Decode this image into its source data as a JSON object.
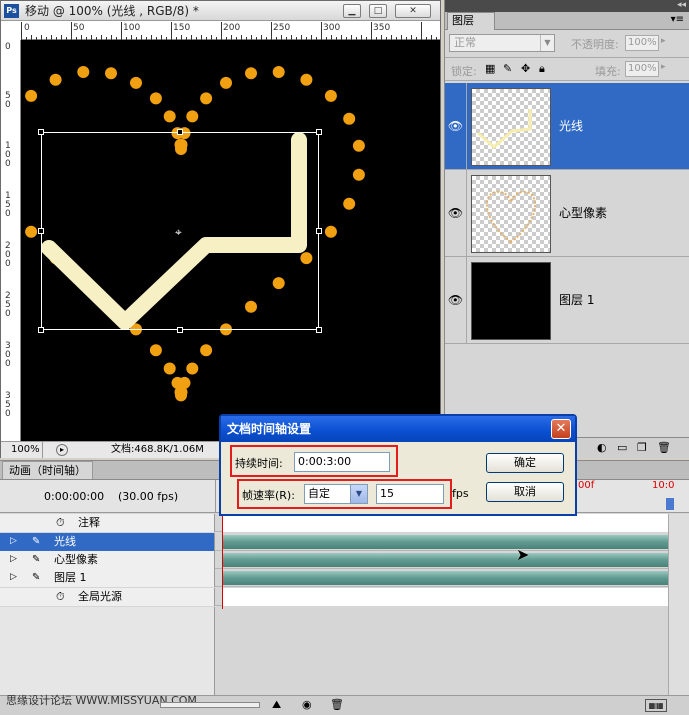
{
  "document": {
    "title": "移动 @ 100% (光线 , RGB/8) *",
    "zoom": "100%",
    "file_size": "文档:468.8K/1.06M",
    "ruler_h": [
      "0",
      "50",
      "100",
      "150",
      "200",
      "250",
      "300",
      "350"
    ],
    "ruler_v": [
      "0",
      "5 0",
      "1 0 0",
      "1 5 0",
      "2 0 0",
      "2 5 0",
      "3 0 0",
      "3 5 0"
    ]
  },
  "layers_panel": {
    "tab": "图层",
    "blend_mode": "正常",
    "opacity_label": "不透明度:",
    "opacity_value": "100%",
    "lock_label": "锁定:",
    "fill_label": "填充:",
    "fill_value": "100%",
    "layers": [
      {
        "name": "光线",
        "selected": true
      },
      {
        "name": "心型像素",
        "selected": false
      },
      {
        "name": "图层 1",
        "selected": false
      }
    ]
  },
  "animation_panel": {
    "tab": "动画（时间轴）",
    "timecode": "0:00:00:00",
    "fps": "(30.00 fps)",
    "ruler_marks": [
      "00f",
      "10:0"
    ],
    "tracks": [
      {
        "name": "注释",
        "type": "global",
        "selected": false
      },
      {
        "name": "光线",
        "type": "layer",
        "selected": true
      },
      {
        "name": "心型像素",
        "type": "layer",
        "selected": false
      },
      {
        "name": "图层 1",
        "type": "layer",
        "selected": false
      },
      {
        "name": "全局光源",
        "type": "global",
        "selected": false
      }
    ]
  },
  "dialog": {
    "title": "文档时间轴设置",
    "duration_label": "持续时间:",
    "duration_value": "0:00:3:00",
    "framerate_label": "帧速率(R):",
    "framerate_select": "自定",
    "framerate_value": "15",
    "fps_unit": "fps",
    "ok_label": "确定",
    "cancel_label": "取消"
  },
  "watermark": "思缘设计论坛 WWW.MISSYUAN.COM",
  "colors": {
    "selection": "#316ac5",
    "dot_orange": "#f0a010",
    "light_stroke": "#f6f0c4",
    "highlight_red": "#e31c1c"
  }
}
